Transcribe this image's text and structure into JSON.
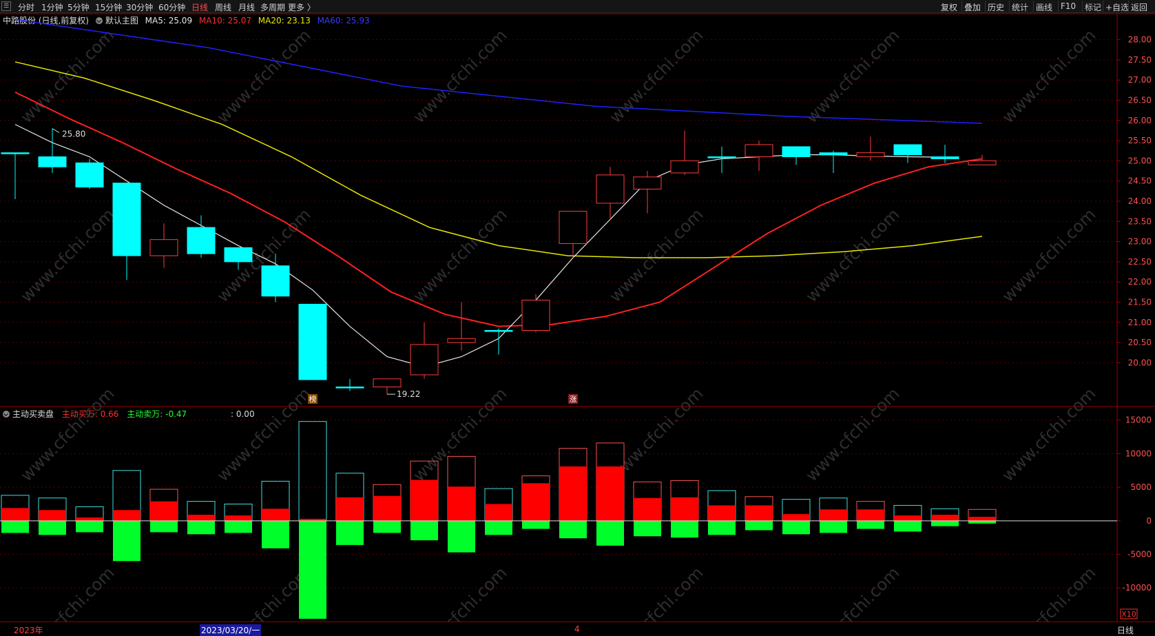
{
  "toolbar": {
    "left_items": [
      "分时",
      "1分钟",
      "5分钟",
      "15分钟",
      "30分钟",
      "60分钟",
      "日线",
      "周线",
      "月线",
      "多周期",
      "更多 〉"
    ],
    "active_item": "日线",
    "right_items": [
      "复权",
      "叠加",
      "历史",
      "统计",
      "画线",
      "F10",
      "标记",
      "+自选",
      "返回"
    ]
  },
  "main_info": {
    "stock": "中路股份 (日线,前复权)",
    "template": "默认主图",
    "ma5": "MA5: 25.09",
    "ma10": "MA10: 25.07",
    "ma20": "MA20: 23.13",
    "ma60": "MA60: 25.93"
  },
  "sub_info": {
    "title": "主动买卖盘",
    "buy": "主动买万: 0.66",
    "sell": "主动卖万: -0.47",
    "other": ": 0.00"
  },
  "annotations": {
    "high": "25.80",
    "low": "19.22",
    "mark1": "榜",
    "mark2": "涨"
  },
  "watermark": "www.cfchi.com",
  "bottom": {
    "year": "2023年",
    "date": "2023/03/20/一",
    "month": "4",
    "period": "日线",
    "zoom": "X10"
  },
  "colors": {
    "up": "#ff3c3c",
    "down": "#00ffff",
    "ma5": "#e8e8e8",
    "ma10": "#ff2020",
    "ma20": "#e8e800",
    "ma60": "#2020ff",
    "buy": "#ff0000",
    "sell": "#00ff2a"
  },
  "chart_data": [
    {
      "type": "candlestick",
      "y_ticks": [
        28.0,
        27.5,
        27.0,
        26.5,
        26.0,
        25.5,
        25.0,
        24.5,
        24.0,
        23.5,
        23.0,
        22.5,
        22.0,
        21.5,
        21.0,
        20.5,
        20.0
      ],
      "ylim": [
        19.0,
        28.3
      ],
      "candles": [
        {
          "o": 25.2,
          "h": 25.2,
          "l": 24.05,
          "c": 25.2
        },
        {
          "o": 25.1,
          "h": 25.8,
          "l": 24.7,
          "c": 24.85
        },
        {
          "o": 24.95,
          "h": 25.05,
          "l": 24.3,
          "c": 24.35
        },
        {
          "o": 24.45,
          "h": 24.45,
          "l": 22.05,
          "c": 22.65
        },
        {
          "o": 22.65,
          "h": 23.45,
          "l": 22.35,
          "c": 23.05
        },
        {
          "o": 23.35,
          "h": 23.65,
          "l": 22.6,
          "c": 22.7
        },
        {
          "o": 22.85,
          "h": 22.85,
          "l": 22.3,
          "c": 22.5
        },
        {
          "o": 22.4,
          "h": 22.7,
          "l": 21.5,
          "c": 21.65
        },
        {
          "o": 21.45,
          "h": 21.45,
          "l": 19.58,
          "c": 19.58
        },
        {
          "o": 19.4,
          "h": 19.6,
          "l": 19.3,
          "c": 19.4
        },
        {
          "o": 19.4,
          "h": 19.6,
          "l": 19.22,
          "c": 19.6
        },
        {
          "o": 19.7,
          "h": 21.0,
          "l": 19.6,
          "c": 20.45
        },
        {
          "o": 20.5,
          "h": 21.5,
          "l": 20.3,
          "c": 20.6
        },
        {
          "o": 20.8,
          "h": 20.85,
          "l": 20.2,
          "c": 20.8
        },
        {
          "o": 20.8,
          "h": 21.7,
          "l": 20.75,
          "c": 21.55
        },
        {
          "o": 22.95,
          "h": 23.75,
          "l": 22.6,
          "c": 23.75
        },
        {
          "o": 23.95,
          "h": 24.85,
          "l": 23.55,
          "c": 24.65
        },
        {
          "o": 24.3,
          "h": 24.75,
          "l": 23.7,
          "c": 24.6
        },
        {
          "o": 24.7,
          "h": 25.75,
          "l": 24.65,
          "c": 25.0
        },
        {
          "o": 25.1,
          "h": 25.35,
          "l": 24.7,
          "c": 25.1
        },
        {
          "o": 25.1,
          "h": 25.5,
          "l": 24.75,
          "c": 25.4
        },
        {
          "o": 25.35,
          "h": 25.35,
          "l": 24.9,
          "c": 25.1
        },
        {
          "o": 25.2,
          "h": 25.25,
          "l": 24.7,
          "c": 25.15
        },
        {
          "o": 25.1,
          "h": 25.6,
          "l": 25.0,
          "c": 25.2
        },
        {
          "o": 25.4,
          "h": 25.4,
          "l": 24.95,
          "c": 25.15
        },
        {
          "o": 25.1,
          "h": 25.4,
          "l": 24.95,
          "c": 25.05
        },
        {
          "o": 24.9,
          "h": 25.15,
          "l": 24.9,
          "c": 25.0
        }
      ],
      "ma5": [
        25.9,
        null,
        null,
        null,
        null,
        null,
        null,
        null,
        21.6,
        20.55,
        20.1,
        19.9,
        20.2,
        20.6,
        21.65,
        22.65,
        23.65,
        24.6,
        24.9,
        25.05,
        25.1,
        25.15,
        25.15,
        25.1,
        25.08
      ],
      "ma10": [
        26.7,
        26.05,
        25.45,
        24.8,
        24.2,
        23.5,
        22.65,
        21.75,
        21.2,
        20.9,
        20.95,
        21.15,
        21.5,
        22.35,
        23.2,
        23.9,
        24.45,
        24.85,
        25.05
      ],
      "ma20": [
        27.45,
        27.05,
        26.5,
        25.9,
        25.1,
        24.15,
        23.35,
        22.9,
        22.65,
        22.6,
        22.6,
        22.65,
        22.75,
        22.9,
        23.13
      ],
      "ma60": [
        28.5,
        27.8,
        26.85,
        26.35,
        26.1,
        25.93
      ]
    },
    {
      "type": "bar",
      "y_ticks": [
        15000,
        10000,
        5000,
        0,
        -5000,
        -10000
      ],
      "ylim": [
        -14800,
        16000
      ],
      "buy": [
        1900,
        1600,
        500,
        1600,
        2900,
        900,
        800,
        1800,
        300,
        3500,
        3700,
        6100,
        5100,
        2500,
        5600,
        8100,
        8100,
        3400,
        3500,
        2300,
        2300,
        1000,
        1700,
        1700,
        800,
        900,
        600
      ],
      "total": [
        3800,
        3400,
        2100,
        7500,
        4700,
        2900,
        2500,
        5900,
        14800,
        7100,
        5400,
        8900,
        9600,
        4800,
        6700,
        10800,
        11600,
        5800,
        6000,
        4500,
        3600,
        3200,
        3400,
        2900,
        2300,
        1800,
        1700
      ],
      "sell": [
        -1800,
        -2100,
        -1700,
        -6000,
        -1700,
        -2000,
        -1800,
        -4100,
        -14600,
        -3600,
        -1800,
        -2900,
        -4700,
        -2100,
        -1200,
        -2600,
        -3700,
        -2300,
        -2500,
        -2100,
        -1400,
        -2000,
        -1800,
        -1200,
        -1600,
        -800,
        -400
      ]
    }
  ]
}
